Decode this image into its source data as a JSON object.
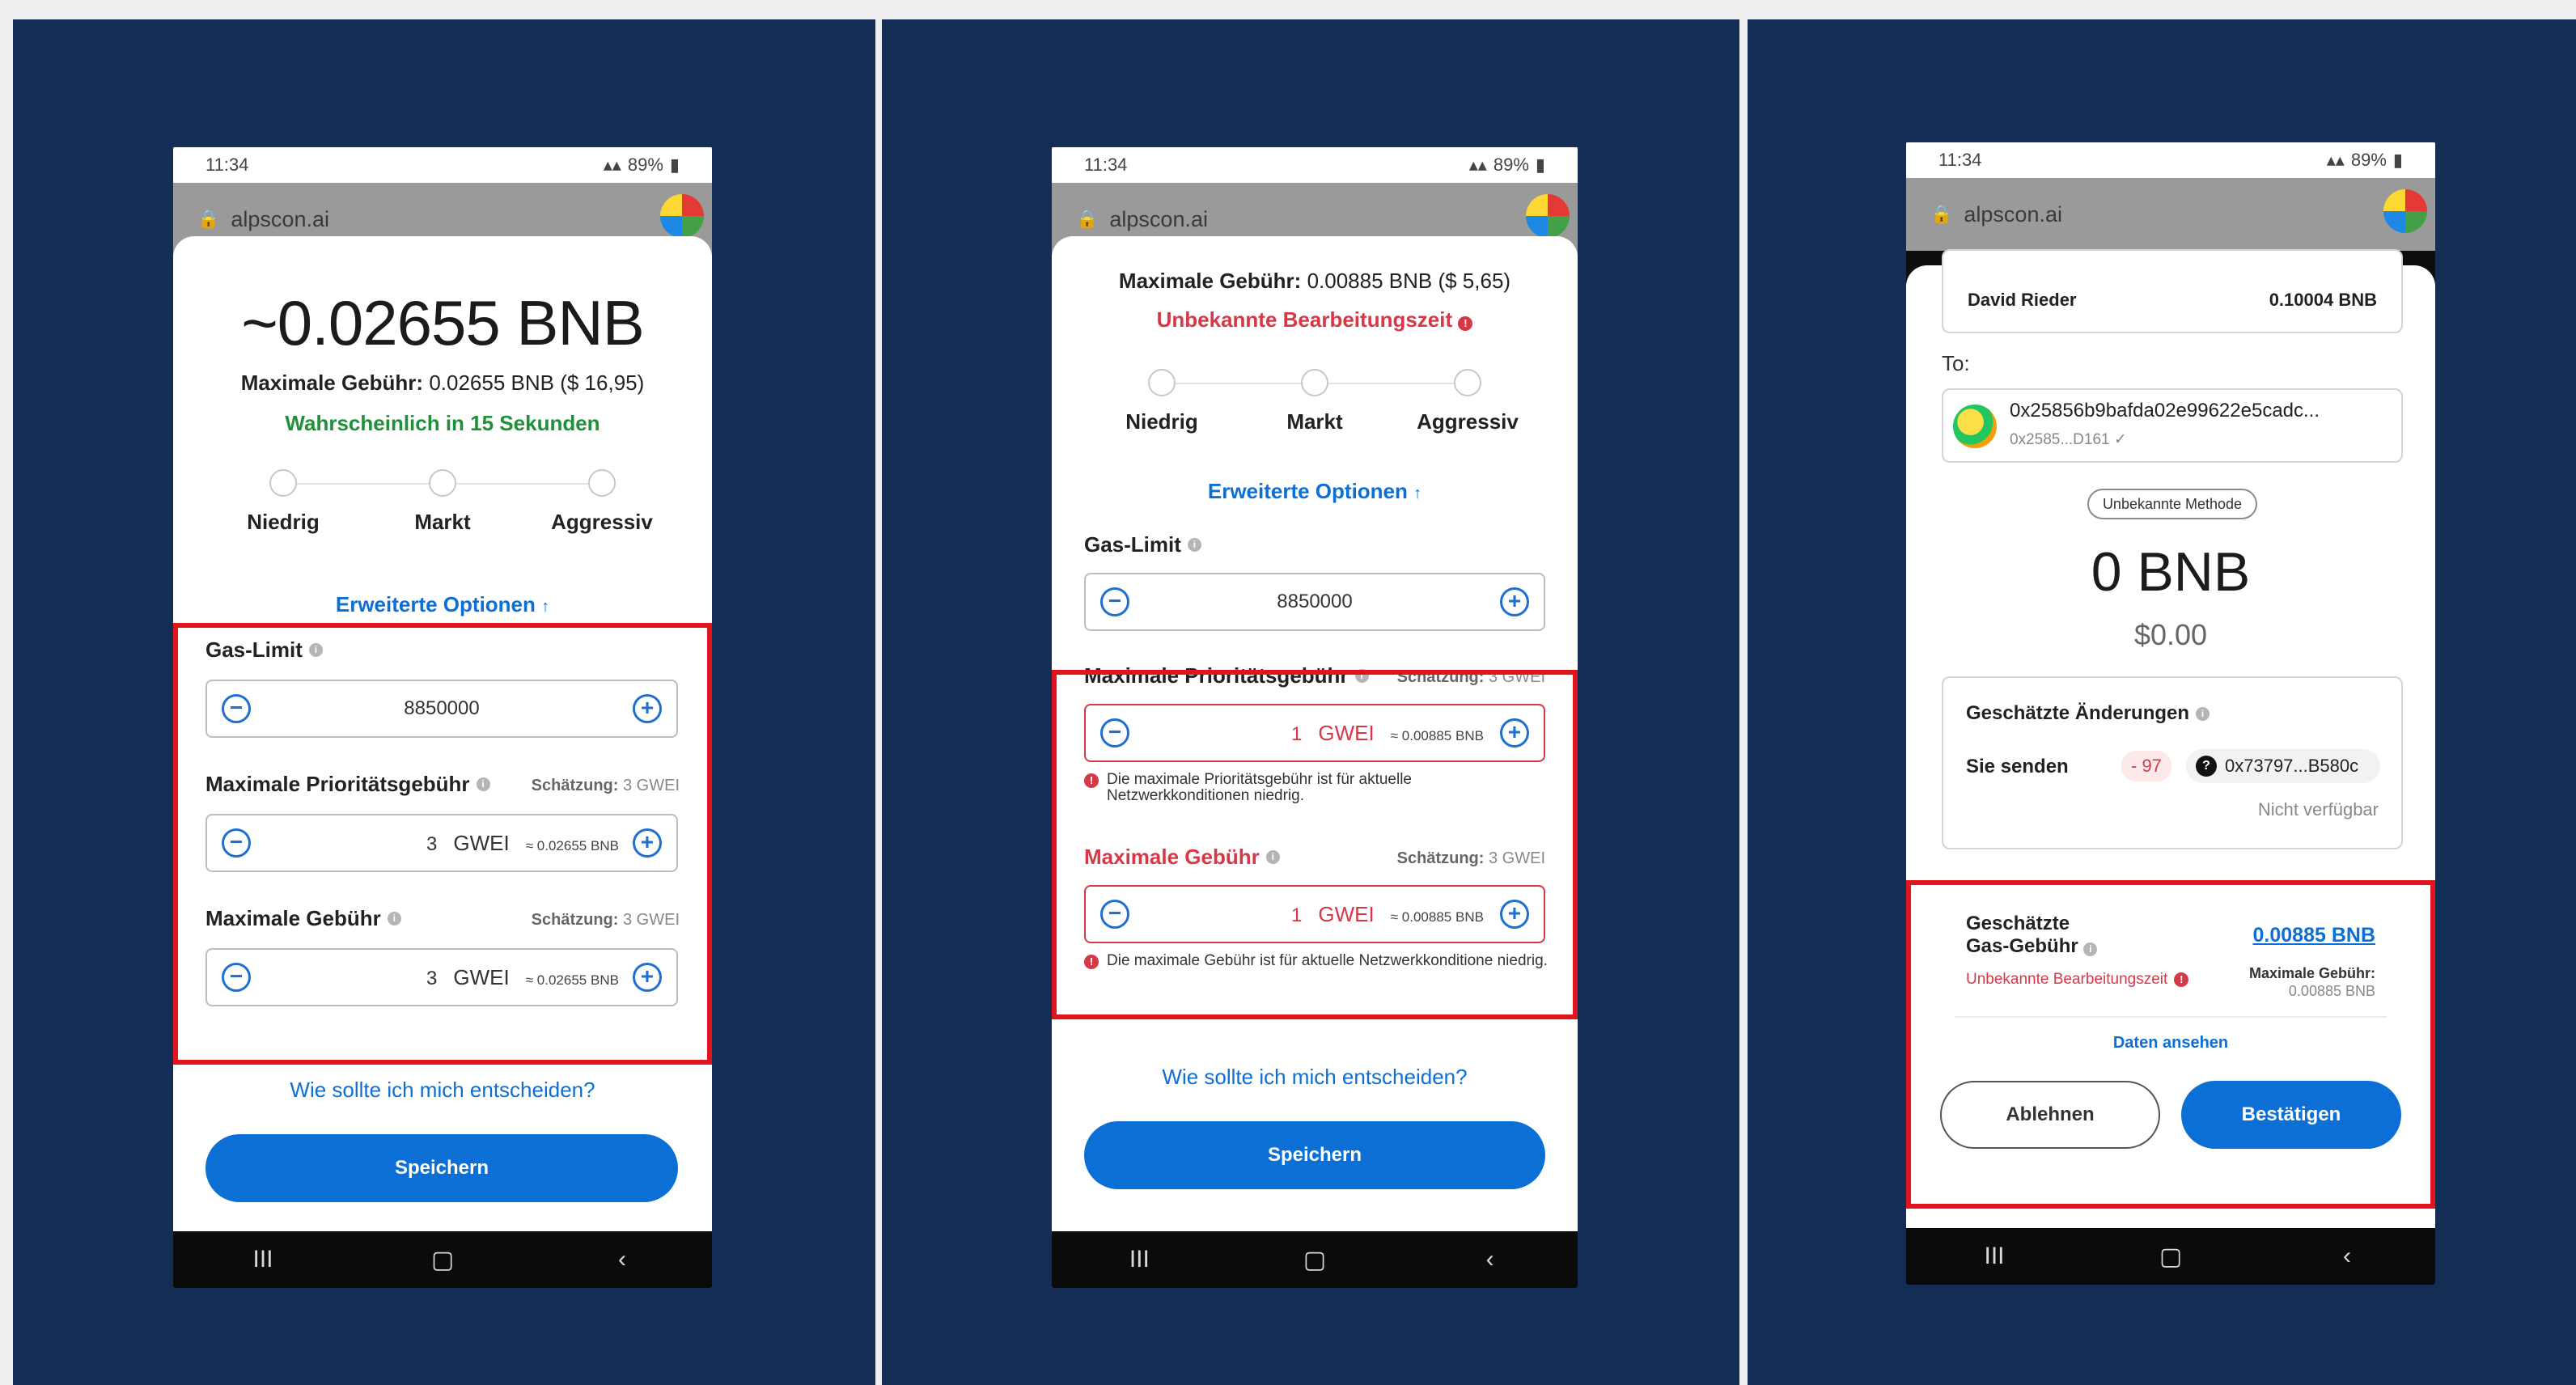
{
  "status": {
    "time": "11:34",
    "battery": "89%"
  },
  "browser": {
    "url": "alpscon.ai"
  },
  "nav": {
    "recents": "III",
    "home": "▢",
    "back": "‹"
  },
  "options": {
    "low": "Niedrig",
    "market": "Markt",
    "aggressive": "Aggressiv"
  },
  "advanced_options": "Erweiterte Optionen",
  "gas_limit_label": "Gas-Limit",
  "priority_fee_label": "Maximale Prioritätsgebühr",
  "max_fee_label": "Maximale Gebühr",
  "estimate_prefix": "Schätzung:",
  "estimate_value": "3 GWEI",
  "unit_gwei": "GWEI",
  "help_link": "Wie sollte ich mich entscheiden?",
  "save_label": "Speichern",
  "screen1": {
    "amount": "~0.02655 BNB",
    "max_fee_prefix": "Maximale Gebühr:",
    "max_fee_value": "0.02655 BNB ($ 16,95)",
    "likely_time": "Wahrscheinlich in 15 Sekunden",
    "gas_limit": "8850000",
    "priority_fee": "3",
    "priority_conv": "≈ 0.02655 BNB",
    "max_fee": "3",
    "max_fee_conv": "≈ 0.02655 BNB"
  },
  "screen2": {
    "max_fee_prefix": "Maximale Gebühr:",
    "max_fee_value": "0.00885 BNB ($ 5,65)",
    "unknown_time": "Unbekannte Bearbeitungszeit",
    "gas_limit": "8850000",
    "priority_fee": "1",
    "priority_conv": "≈ 0.00885 BNB",
    "priority_error": "Die maximale Prioritätsgebühr ist für aktuelle Netzwerkkonditionen niedrig.",
    "max_fee": "1",
    "max_fee_conv": "≈ 0.00885 BNB",
    "max_fee_error": "Die maximale Gebühr ist für aktuelle Netzwerkkonditione niedrig."
  },
  "screen3": {
    "from_name": "David Rieder",
    "from_amount": "0.10004 BNB",
    "to_label": "To:",
    "to_address": "0x25856b9bafda02e99622e5cadc...",
    "to_short": "0x2585...D161",
    "method": "Unbekannte Methode",
    "amount": "0 BNB",
    "usd": "$0.00",
    "changes_label": "Geschätzte Änderungen",
    "you_send": "Sie senden",
    "send_value": "- 97",
    "send_address": "0x73797...B580c",
    "not_available": "Nicht verfügbar",
    "gas_fee_label": "Geschätzte Gas-Gebühr",
    "gas_fee_value": "0.00885 BNB",
    "unknown_time": "Unbekannte Bearbeitungszeit",
    "max_fee_label": "Maximale Gebühr:",
    "max_fee_value": "0.00885 BNB",
    "view_data": "Daten ansehen",
    "reject": "Ablehnen",
    "confirm": "Bestätigen"
  }
}
